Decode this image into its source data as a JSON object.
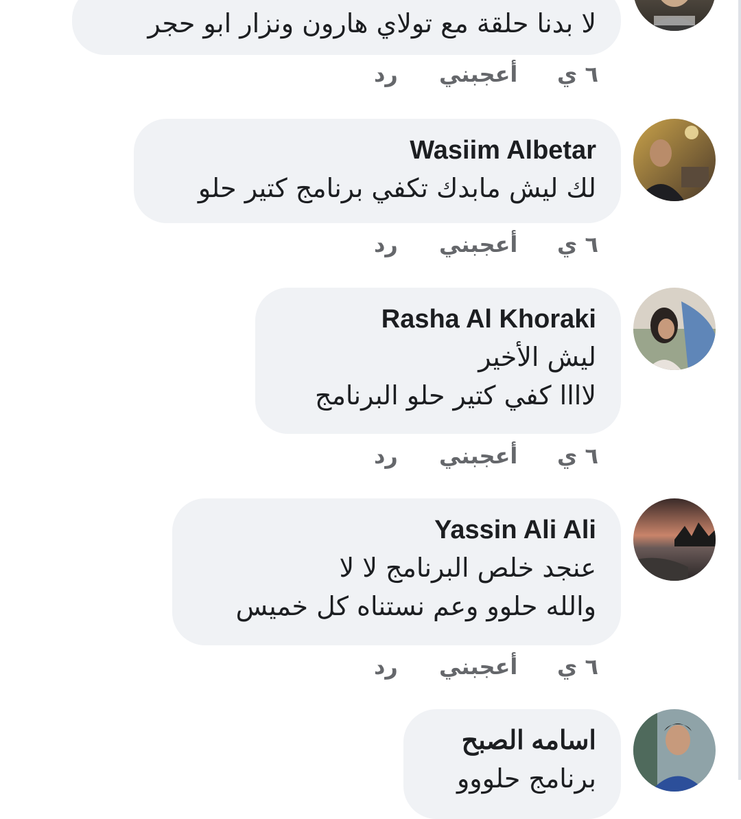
{
  "comments": [
    {
      "author": "",
      "lines": [
        "لا بدنا حلقة مع تولاي هارون ونزار ابو حجر"
      ],
      "time": "٦ ي",
      "like_label": "أعجبني",
      "reply_label": "رد"
    },
    {
      "author": "Wasiim Albetar",
      "lines": [
        "لك ليش مابدك تكفي برنامج كتير حلو"
      ],
      "time": "٦ ي",
      "like_label": "أعجبني",
      "reply_label": "رد"
    },
    {
      "author": "Rasha Al Khoraki",
      "lines": [
        "ليش الأخير",
        "لاااا كفي كتير حلو البرنامج"
      ],
      "time": "٦ ي",
      "like_label": "أعجبني",
      "reply_label": "رد"
    },
    {
      "author": "Yassin Ali Ali",
      "lines": [
        "عنجد خلص البرنامج لا لا",
        "والله حلوو وعم نستناه كل خميس"
      ],
      "time": "٦ ي",
      "like_label": "أعجبني",
      "reply_label": "رد"
    },
    {
      "author": "اسامه الصبح",
      "lines": [
        "برنامج حلووو"
      ],
      "time": "",
      "like_label": "",
      "reply_label": ""
    }
  ],
  "colors": {
    "bubble_bg": "#f0f2f5",
    "text": "#1c1e21",
    "meta": "#65676b"
  }
}
